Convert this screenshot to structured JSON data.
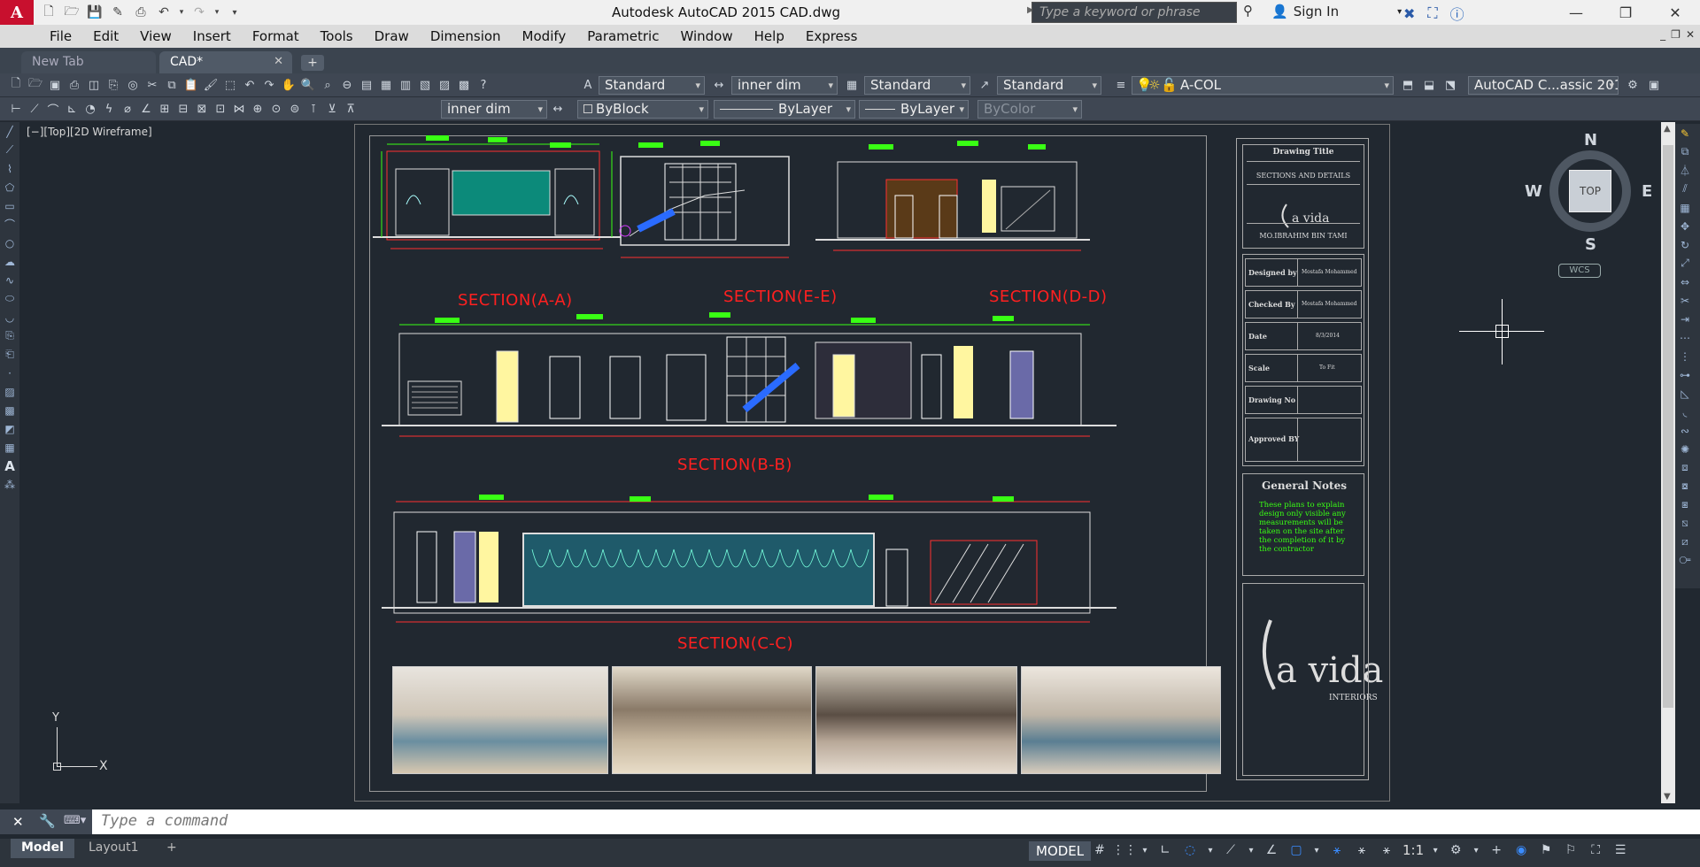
{
  "window": {
    "title": "Autodesk AutoCAD 2015    CAD.dwg",
    "search_placeholder": "Type a keyword or phrase",
    "sign_in": "Sign In",
    "app_letter": "A"
  },
  "menu": [
    "File",
    "Edit",
    "View",
    "Insert",
    "Format",
    "Tools",
    "Draw",
    "Dimension",
    "Modify",
    "Parametric",
    "Window",
    "Help",
    "Express"
  ],
  "tabs": {
    "new_tab": "New Tab",
    "active": "CAD*"
  },
  "toolbar1": {
    "text_style": "Standard",
    "dim_style": "inner dim",
    "table_style": "Standard",
    "mleader_style": "Standard",
    "layer": "A-COL",
    "workspace": "AutoCAD C...assic 201"
  },
  "toolbar2": {
    "dim_style": "inner dim",
    "color": "ByBlock",
    "linetype": "ByLayer",
    "lineweight": "ByLayer",
    "plotstyle": "ByColor"
  },
  "viewport_label": "[−][Top][2D Wireframe]",
  "drawing": {
    "sections": [
      "SECTION(A-A)",
      "SECTION(E-E)",
      "SECTION(D-D)",
      "SECTION(B-B)",
      "SECTION(C-C)"
    ]
  },
  "title_block": {
    "drawing_title_label": "Drawing Title",
    "drawing_title": "SECTIONS AND DETAILS",
    "client": "MO.IBRAHIM BIN TAMI",
    "rows": [
      {
        "label": "Designed by",
        "value": "Mostafa Mohammed"
      },
      {
        "label": "Checked By",
        "value": "Mostafa Mohammed"
      },
      {
        "label": "Date",
        "value": "8/3/2014"
      },
      {
        "label": "Scale",
        "value": "To Fit"
      },
      {
        "label": "Drawing No",
        "value": ""
      },
      {
        "label": "Approved BY",
        "value": ""
      }
    ],
    "notes_title": "General Notes",
    "notes_body": "These plans to explain design only visible any measurements will be taken on the site after the completion of it by the contractor"
  },
  "viewcube": {
    "top": "TOP",
    "n": "N",
    "s": "S",
    "e": "E",
    "w": "W",
    "wcs": "WCS"
  },
  "ucs": {
    "y": "Y",
    "x": "X"
  },
  "command": {
    "placeholder": "Type a command"
  },
  "status": {
    "model_tab": "Model",
    "layout_tab": "Layout1",
    "model_button": "MODEL",
    "scale": "1:1"
  }
}
